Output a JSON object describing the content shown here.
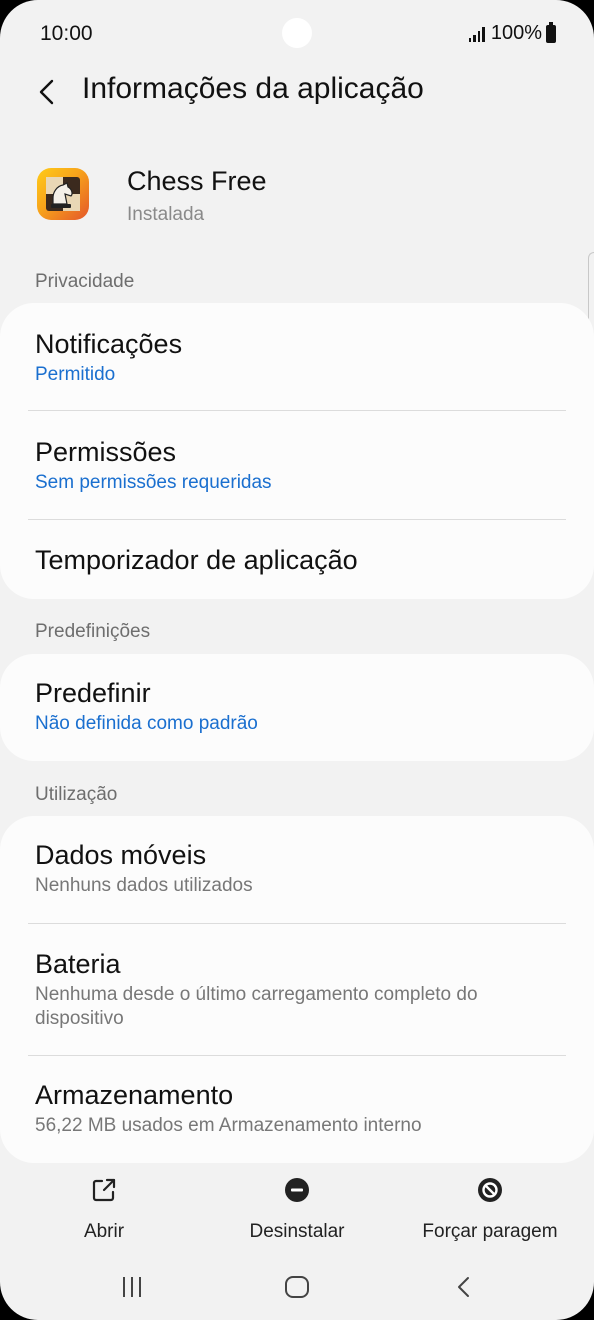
{
  "status_bar": {
    "time": "10:00",
    "battery": "100%"
  },
  "header": {
    "title": "Informações da aplicação"
  },
  "app": {
    "name": "Chess Free",
    "status": "Instalada"
  },
  "sections": {
    "privacy": "Privacidade",
    "defaults": "Predefinições",
    "usage": "Utilização"
  },
  "privacy_items": [
    {
      "title": "Notificações",
      "subtitle": "Permitido"
    },
    {
      "title": "Permissões",
      "subtitle": "Sem permissões requeridas"
    },
    {
      "title": "Temporizador de aplicação"
    }
  ],
  "defaults_items": [
    {
      "title": "Predefinir",
      "subtitle": "Não definida como padrão"
    }
  ],
  "usage_items": [
    {
      "title": "Dados móveis",
      "subtitle": "Nenhuns dados utilizados"
    },
    {
      "title": "Bateria",
      "subtitle": "Nenhuma desde o último carregamento completo do dispositivo"
    },
    {
      "title": "Armazenamento",
      "subtitle": "56,22 MB usados em Armazenamento interno"
    }
  ],
  "actions": [
    {
      "label": "Abrir",
      "icon": "open-external-icon"
    },
    {
      "label": "Desinstalar",
      "icon": "minus-circle-icon"
    },
    {
      "label": "Forçar paragem",
      "icon": "block-circle-icon"
    }
  ],
  "nav": [
    "recent-apps-icon",
    "home-icon",
    "back-icon"
  ],
  "colors": {
    "accent": "#1a6fcf",
    "background": "#f2f2f2",
    "card": "#fcfcfc"
  }
}
